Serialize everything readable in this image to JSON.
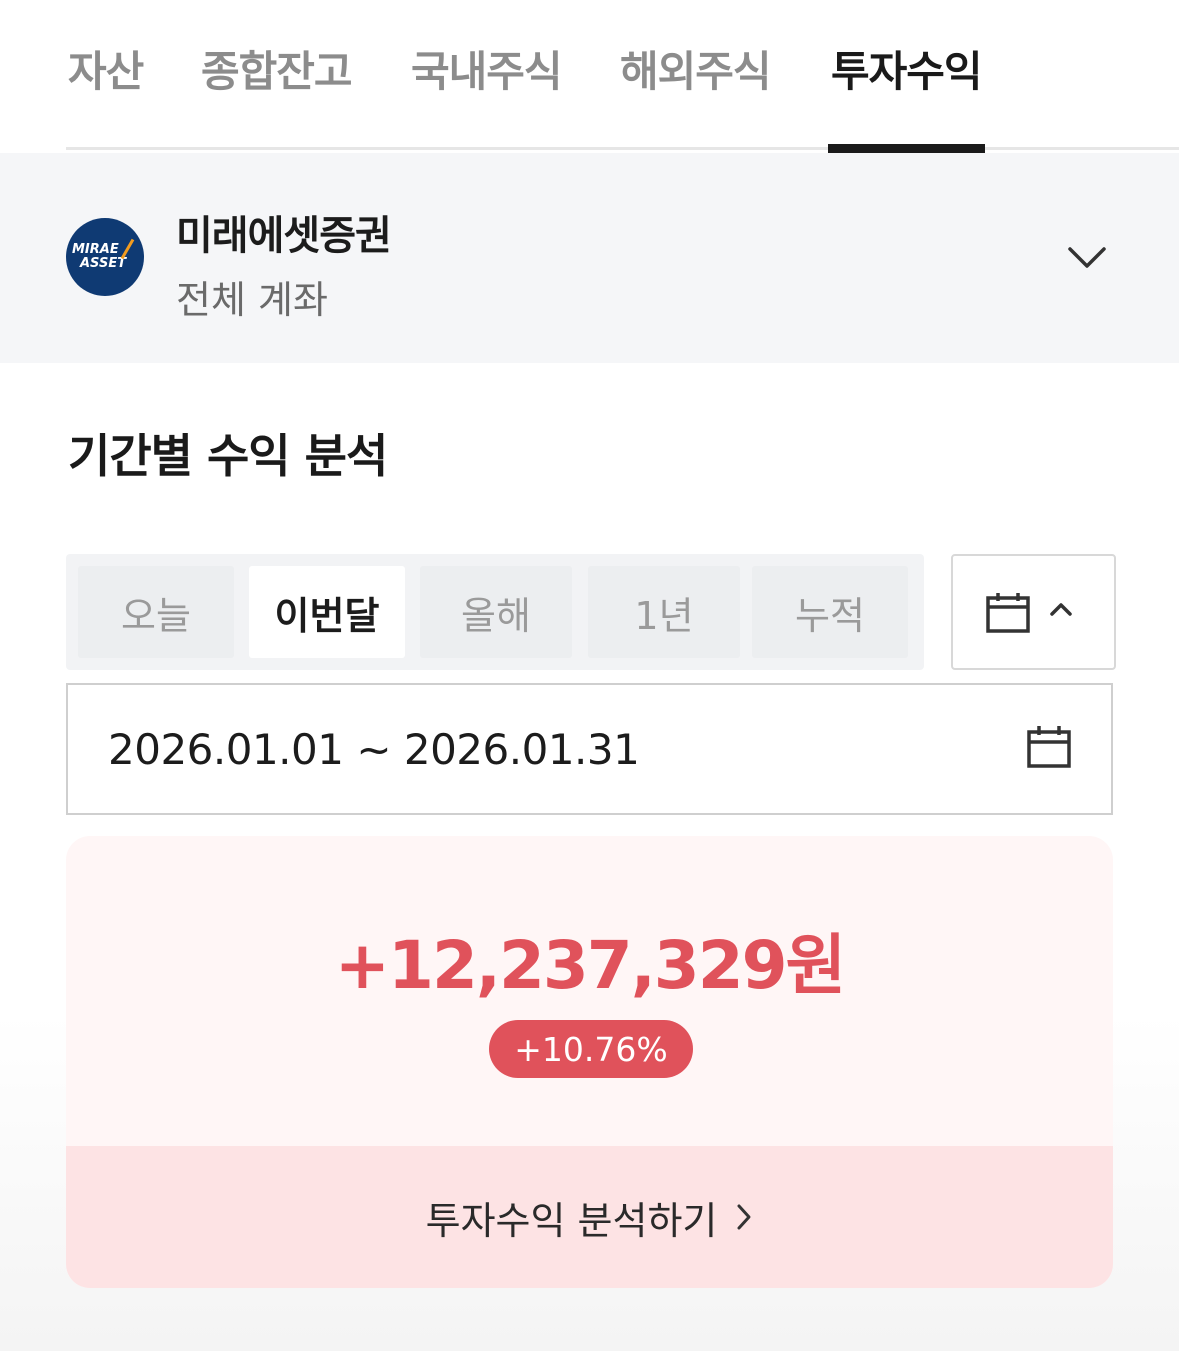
{
  "tabs": [
    {
      "label": "자산",
      "active": false
    },
    {
      "label": "종합잔고",
      "active": false
    },
    {
      "label": "국내주식",
      "active": false
    },
    {
      "label": "해외주식",
      "active": false
    },
    {
      "label": "투자수익",
      "active": true
    }
  ],
  "account": {
    "logo_line1": "MIRAE",
    "logo_line2": "ASSET",
    "broker": "미래에셋증권",
    "type": "전체 계좌",
    "dropdown_icon": "chevron-down-icon"
  },
  "section": {
    "title": "기간별 수익 분석"
  },
  "period": {
    "options": [
      "오늘",
      "이번달",
      "올해",
      "1년",
      "누적"
    ],
    "selected": "이번달",
    "toggle_icons": [
      "calendar-icon",
      "chevron-up-icon"
    ]
  },
  "date_range": {
    "value": "2026.01.01 ~ 2026.01.31",
    "icon": "calendar-icon"
  },
  "summary": {
    "amount": "+12,237,329원",
    "rate": "+10.76%",
    "link_label": "투자수익 분석하기",
    "link_icon": "chevron-right-icon"
  },
  "colors": {
    "profit": "#e0525b",
    "active_tab": "#1a1a1a",
    "summary_bg": "#fff6f6",
    "link_bg": "#fde3e4"
  }
}
